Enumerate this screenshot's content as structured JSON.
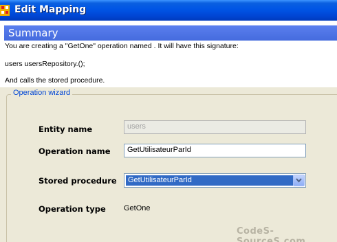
{
  "window": {
    "title": "Edit Mapping",
    "icon": "window-app-icon"
  },
  "summary": {
    "title": "Summary",
    "lines": [
      "You are creating a \"GetOne\" operation named . It will have this signature:",
      "users usersRepository.();",
      "And calls the  stored procedure."
    ]
  },
  "wizard": {
    "legend": "Operation wizard",
    "entity_name": {
      "label": "Entity name",
      "value": "users"
    },
    "operation_name": {
      "label": "Operation name",
      "value": "GetUtilisateurParId"
    },
    "stored_procedure": {
      "label": "Stored procedure",
      "selected": "GetUtilisateurParId"
    },
    "operation_type": {
      "label": "Operation type",
      "value": "GetOne"
    }
  },
  "watermark": "CodeS-SourceS.com",
  "colors": {
    "titlebar": "#0055e5",
    "summary_header": "#4b6fe0",
    "selection": "#316ac5",
    "legend": "#0046d5",
    "dialog_bg": "#ece9d8"
  }
}
